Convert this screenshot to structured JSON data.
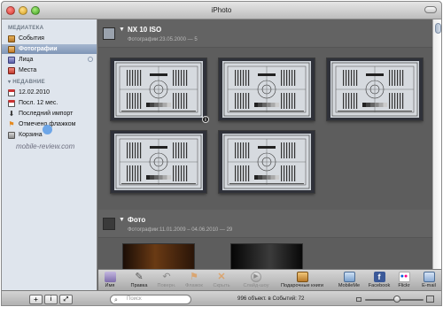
{
  "window": {
    "title": "iPhoto"
  },
  "sidebar": {
    "library_header": "МЕДИАТЕКА",
    "library_items": [
      {
        "label": "События",
        "icon": "events-icon"
      },
      {
        "label": "Фотографии",
        "icon": "photos-icon",
        "selected": true
      },
      {
        "label": "Лица",
        "icon": "faces-icon"
      },
      {
        "label": "Места",
        "icon": "places-icon"
      }
    ],
    "recent_header": "НЕДАВНИЕ",
    "recent_items": [
      {
        "label": "12.02.2010",
        "icon": "calendar-icon"
      },
      {
        "label": "Посл. 12 мес.",
        "icon": "calendar-icon"
      },
      {
        "label": "Последний импорт",
        "icon": "import-icon"
      },
      {
        "label": "Отмечено флажком",
        "icon": "flag-icon"
      },
      {
        "label": "Корзина",
        "icon": "trash-icon"
      }
    ]
  },
  "events": [
    {
      "title": "NX 10 ISO",
      "subtitle": "Фотографии:23.05.2000 — 5"
    },
    {
      "title": "Фото",
      "subtitle": "Фотографии:11.01.2009 – 04.06.2010 — 29"
    }
  ],
  "toolbar": {
    "buttons": [
      {
        "label": "Имя",
        "icon": "name-icon",
        "enabled": true
      },
      {
        "label": "Правка",
        "icon": "edit-icon",
        "enabled": true
      },
      {
        "label": "Поверн.",
        "icon": "rotate-icon",
        "enabled": false
      },
      {
        "label": "Флажок",
        "icon": "flag-icon",
        "enabled": false
      },
      {
        "label": "Скрыть",
        "icon": "hide-icon",
        "enabled": false
      },
      {
        "label": "Слайд-шоу",
        "icon": "slideshow-icon",
        "enabled": false
      },
      {
        "label": "Подарочные книги",
        "icon": "gift-books-icon",
        "enabled": true
      },
      {
        "label": "MobileMe",
        "icon": "mobileme-icon",
        "enabled": true
      },
      {
        "label": "Facebook",
        "icon": "facebook-icon",
        "enabled": true
      },
      {
        "label": "Flickr",
        "icon": "flickr-icon",
        "enabled": true
      },
      {
        "label": "E-mail",
        "icon": "email-icon",
        "enabled": true
      }
    ]
  },
  "bottombar": {
    "add_label": "+",
    "info_label": "i",
    "fullscreen_label": "⤢",
    "search_placeholder": "Поиск",
    "status": "996 объект. в Событий: 72",
    "zoom": 0.55
  },
  "watermark": "mobile-review.com",
  "colors": {
    "selection": "#7f95b6",
    "sidebar_bg": "#dfe5ed",
    "content_bg": "#5d5d5d"
  }
}
